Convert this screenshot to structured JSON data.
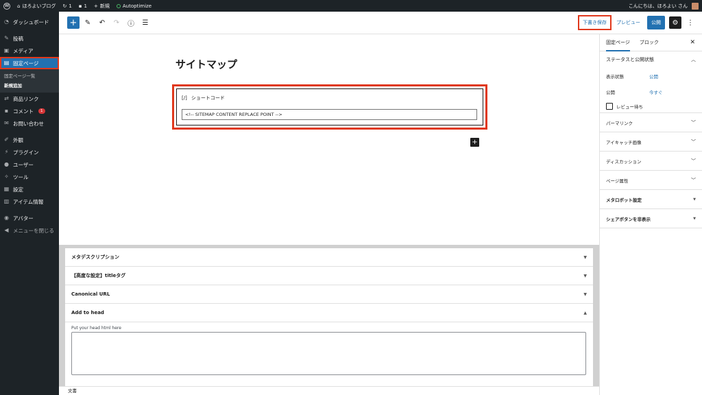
{
  "admin_bar": {
    "site_name": "ほろよいブログ",
    "updates_count": "1",
    "comments_count": "1",
    "new_label": "新規",
    "autoptimize_label": "Autoptimize",
    "greeting": "こんにちは、ほろよい さん"
  },
  "sidebar": {
    "dashboard": "ダッシュボード",
    "posts": "投稿",
    "media": "メディア",
    "pages": "固定ページ",
    "pages_sub_all": "固定ページ一覧",
    "pages_sub_new": "新規追加",
    "product_links": "商品リンク",
    "comments": "コメント",
    "comments_badge": "1",
    "contact": "お問い合わせ",
    "appearance": "外観",
    "plugins": "プラグイン",
    "users": "ユーザー",
    "tools": "ツール",
    "settings": "設定",
    "item_info": "アイテム情報",
    "avatar": "アバター",
    "collapse": "メニューを閉じる"
  },
  "toolbar": {
    "save_draft": "下書き保存",
    "preview": "プレビュー",
    "publish": "公開"
  },
  "editor": {
    "page_title": "サイトマップ",
    "shortcode_label": "ショートコード",
    "shortcode_icon": "[/]",
    "shortcode_value": "<!-- SITEMAP CONTENT REPLACE POINT -->"
  },
  "meta_boxes": {
    "rows": [
      "メタデスクリプション",
      "【高度な設定】titleタグ",
      "Canonical URL",
      "Add to head"
    ],
    "head_hint": "Put your head html here"
  },
  "footer": {
    "breadcrumb": "文書"
  },
  "settings_panel": {
    "tab_page": "固定ページ",
    "tab_block": "ブロック",
    "status_title": "ステータスと公開状態",
    "visibility_label": "表示状態",
    "visibility_value": "公開",
    "publish_label": "公開",
    "publish_value": "今すぐ",
    "pending_review": "レビュー待ち",
    "permalink": "パーマリンク",
    "featured_image": "アイキャッチ画像",
    "discussion": "ディスカッション",
    "page_attributes": "ページ属性",
    "meta_robots": "メタロボット設定",
    "hide_share": "シェアボタンを非表示"
  },
  "colors": {
    "accent": "#2271b1",
    "highlight": "#e0381c",
    "admin_dark": "#1d2327"
  }
}
